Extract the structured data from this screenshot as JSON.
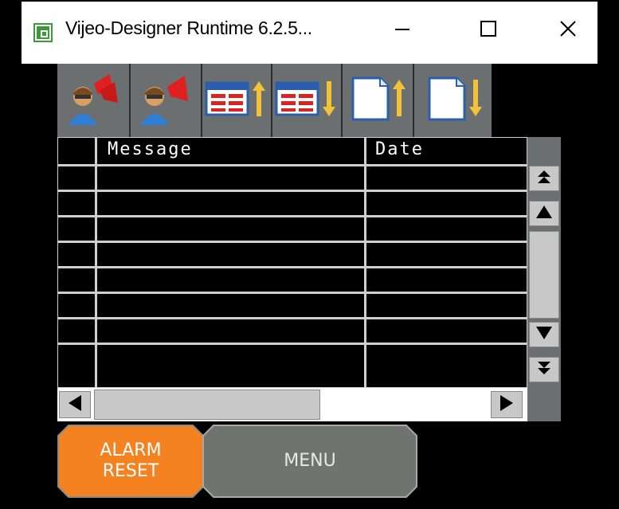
{
  "window": {
    "title": "Vijeo-Designer Runtime 6.2.5...",
    "minimize_label": "—",
    "close_label": "✕"
  },
  "toolbar": {
    "buttons": [
      {
        "name": "acknowledge-all-alarms",
        "icon": "operator-alarm-bells-icon"
      },
      {
        "name": "acknowledge-alarm",
        "icon": "operator-alarm-bell-icon"
      },
      {
        "name": "scroll-page-up",
        "icon": "table-up-arrow-icon"
      },
      {
        "name": "scroll-page-down",
        "icon": "table-down-arrow-icon"
      },
      {
        "name": "first-page",
        "icon": "document-up-arrow-icon"
      },
      {
        "name": "last-page",
        "icon": "document-down-arrow-icon"
      }
    ]
  },
  "table": {
    "columns": [
      "",
      "Message",
      "Date"
    ],
    "row_count": 8,
    "rows": []
  },
  "buttons": {
    "alarm_reset_line1": "ALARM",
    "alarm_reset_line2": "RESET",
    "menu": "MENU"
  },
  "colors": {
    "background": "#000000",
    "toolbar": "#6b6f6f",
    "alarm_reset": "#f58220",
    "menu": "#6f7470",
    "grid": "#cfcfcf"
  }
}
